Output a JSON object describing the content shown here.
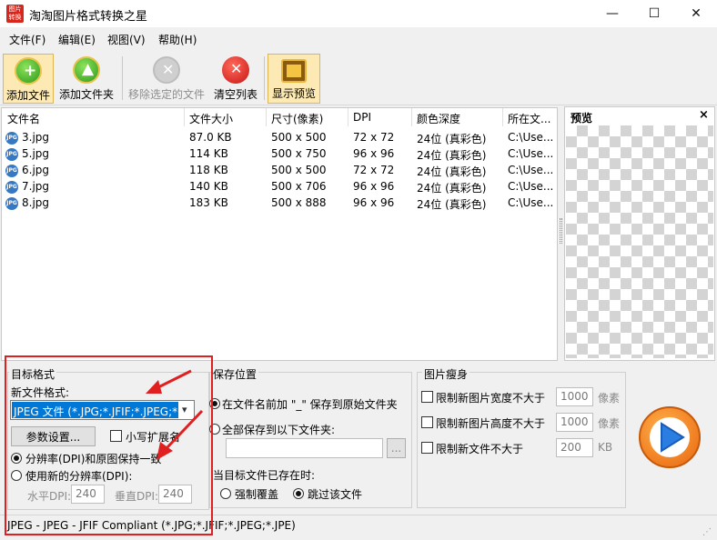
{
  "window": {
    "title": "淘淘图片格式转换之星",
    "icon_text": "图片 转换",
    "minimize": "—",
    "maximize": "☐",
    "close": "✕"
  },
  "menu": [
    "文件(F)",
    "编辑(E)",
    "视图(V)",
    "帮助(H)"
  ],
  "toolbar": {
    "add_file": "添加文件",
    "add_folder": "添加文件夹",
    "remove_selected": "移除选定的文件",
    "clear_list": "清空列表",
    "show_preview": "显示预览"
  },
  "file_list": {
    "columns": [
      "文件名",
      "文件大小",
      "尺寸(像素)",
      "DPI",
      "颜色深度",
      "所在文..."
    ],
    "icon_label": "JPG",
    "rows": [
      [
        "3.jpg",
        "87.0 KB",
        "500 x 500",
        "72 x 72",
        "24位 (真彩色)",
        "C:\\Use..."
      ],
      [
        "5.jpg",
        "114 KB",
        "500 x 750",
        "96 x 96",
        "24位 (真彩色)",
        "C:\\Use..."
      ],
      [
        "6.jpg",
        "118 KB",
        "500 x 500",
        "72 x 72",
        "24位 (真彩色)",
        "C:\\Use..."
      ],
      [
        "7.jpg",
        "140 KB",
        "500 x 706",
        "96 x 96",
        "24位 (真彩色)",
        "C:\\Use..."
      ],
      [
        "8.jpg",
        "183 KB",
        "500 x 888",
        "96 x 96",
        "24位 (真彩色)",
        "C:\\Use..."
      ]
    ]
  },
  "preview": {
    "title": "预览",
    "close": "×"
  },
  "target_format": {
    "title": "目标格式",
    "new_format_label": "新文件格式:",
    "format_value": "JPEG 文件 (*.JPG;*.JFIF;*.JPEG;*",
    "params_button": "参数设置...",
    "lowercase_ext": "小写扩展名",
    "dpi_keep": "分辨率(DPI)和原图保持一致",
    "dpi_new": "使用新的分辨率(DPI):",
    "h_dpi_label": "水平DPI:",
    "h_dpi_value": "240",
    "v_dpi_label": "垂直DPI:",
    "v_dpi_value": "240"
  },
  "save_location": {
    "title": "保存位置",
    "option_prefix": "在文件名前加 \"_\" 保存到原始文件夹",
    "option_folder": "全部保存到以下文件夹:",
    "browse": "...",
    "exists_label": "当目标文件已存在时:",
    "overwrite": "强制覆盖",
    "skip": "跳过该文件"
  },
  "slim": {
    "title": "图片瘦身",
    "limit_width": "限制新图片宽度不大于",
    "width_value": "1000",
    "width_unit": "像素",
    "limit_height": "限制新图片高度不大于",
    "height_value": "1000",
    "height_unit": "像素",
    "limit_size": "限制新文件不大于",
    "size_value": "200",
    "size_unit": "KB"
  },
  "status": {
    "text": "JPEG - JPEG - JFIF Compliant (*.JPG;*.JFIF;*.JPEG;*.JPE)"
  },
  "colors": {
    "selection": "#0078d7",
    "annotation_red": "#e02020",
    "start_orange": "#f47a1f",
    "start_blue": "#2a7de1"
  }
}
